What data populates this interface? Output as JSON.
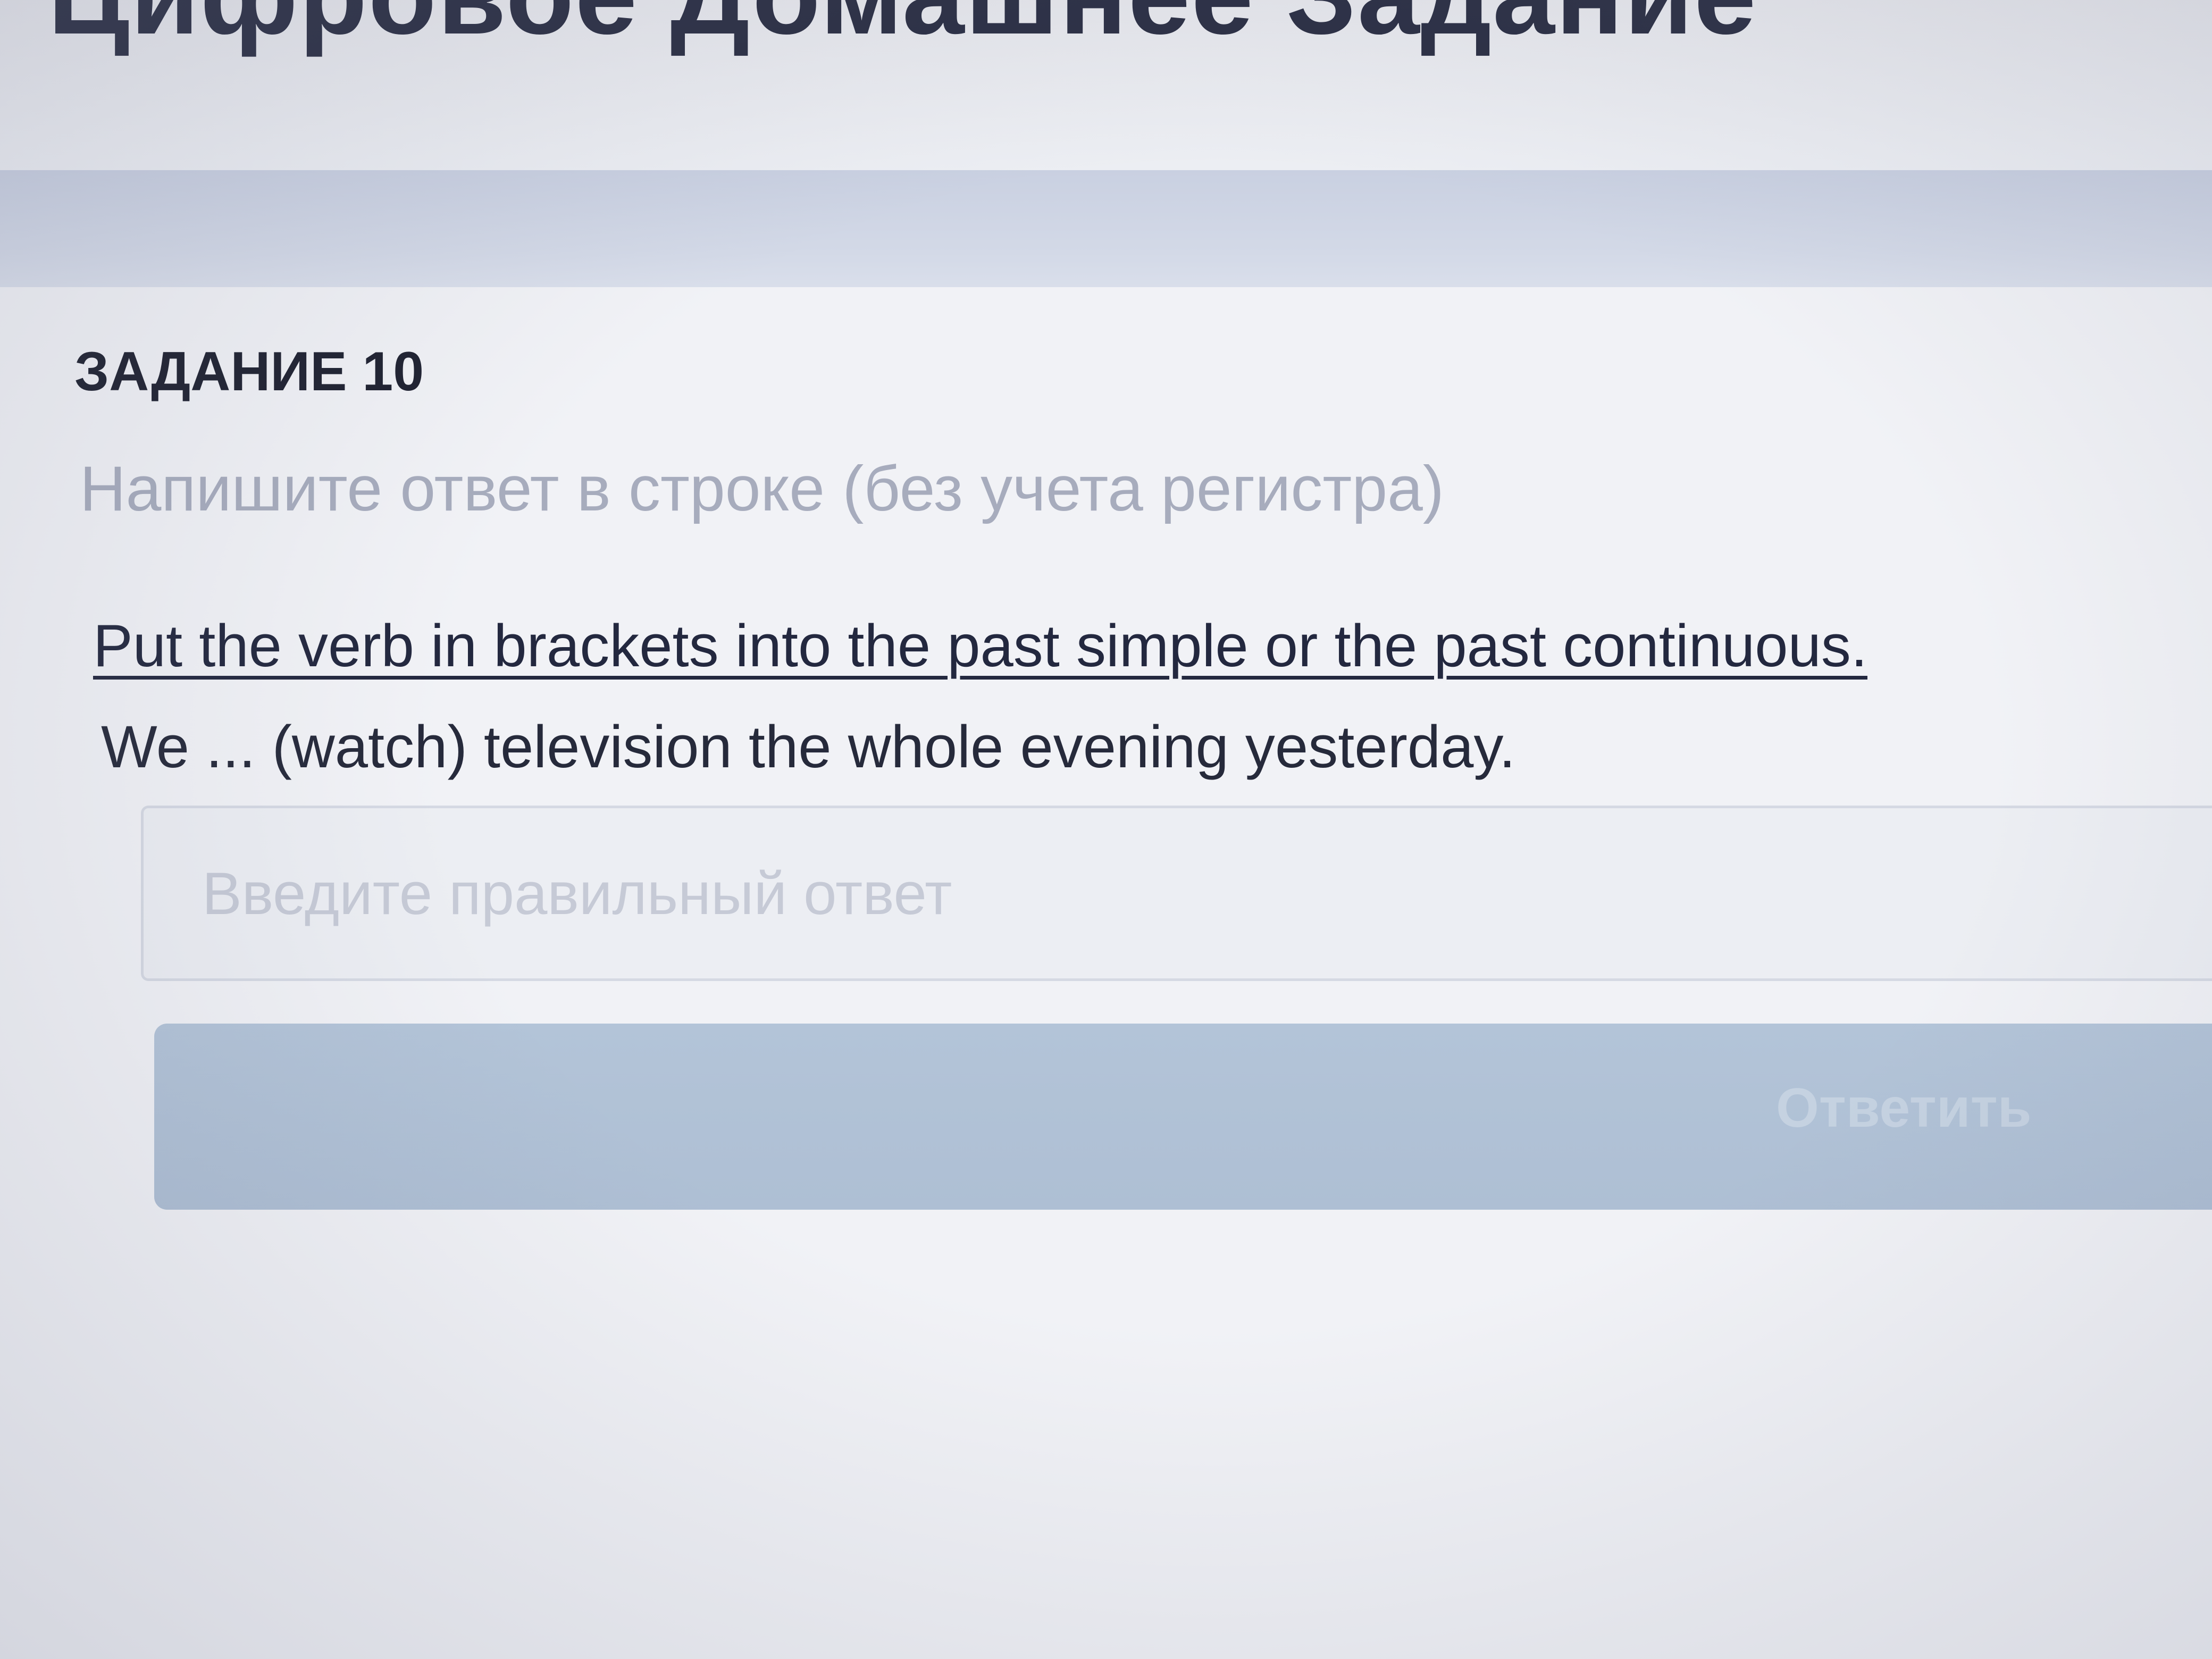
{
  "header": {
    "title": "Цифровое Домашнее Задание"
  },
  "task": {
    "number_label": "ЗАДАНИЕ 10",
    "instruction": "Напишите ответ в строке (без учета регистра)",
    "question": "Put the verb in brackets into the past simple or the past continuous.",
    "sentence": "We ... (watch) television the whole evening yesterday."
  },
  "answer": {
    "value": "",
    "placeholder": "Введите правильный ответ"
  },
  "submit": {
    "label": "Ответить"
  },
  "colors": {
    "title_text": "#2b2f44",
    "header_band": "#cfd6e5",
    "instruction_text": "#a7acbd",
    "question_text": "#23283f",
    "submit_button": "#b0c1d6",
    "submit_text": "#c5d2e1"
  }
}
